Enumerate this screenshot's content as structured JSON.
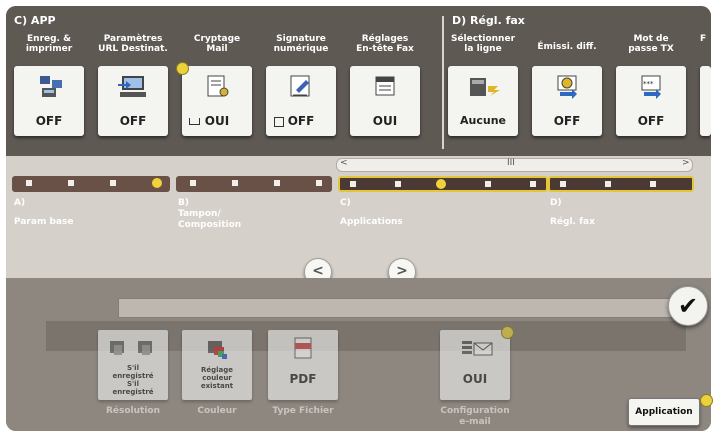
{
  "section_app": {
    "title": "C)  APP"
  },
  "section_fax": {
    "title": "D)  Régl. fax"
  },
  "app_buttons": [
    {
      "label": "Enreg. &\nimprimer",
      "value": "OFF",
      "icon": "scan-save-icon"
    },
    {
      "label": "Paramètres\nURL Destinat.",
      "value": "OFF",
      "icon": "url-destination-icon"
    },
    {
      "label": "Cryptage\nMail",
      "value": "OUI",
      "icon": "encrypt-mail-icon"
    },
    {
      "label": "Signature\nnumérique",
      "value": "OFF",
      "icon": "digital-signature-icon"
    },
    {
      "label": "Réglages\nEn-tête Fax",
      "value": "OUI",
      "icon": "fax-header-icon"
    }
  ],
  "fax_buttons": [
    {
      "label": "Sélectionner\nla ligne",
      "value": "Aucune",
      "icon": "line-select-icon"
    },
    {
      "label": "Émissi. diff.",
      "value": "OFF",
      "icon": "timer-send-icon"
    },
    {
      "label": "Mot de\npasse TX",
      "value": "OFF",
      "icon": "password-tx-icon"
    },
    {
      "label": "F"
    }
  ],
  "scroll": {
    "left": "<",
    "center": "III",
    "right": ">"
  },
  "tabs": [
    {
      "letter": "A)",
      "name": "Param base"
    },
    {
      "letter": "B)",
      "name": "Tampon/\nComposition"
    },
    {
      "letter": "C)",
      "name": "Applications"
    },
    {
      "letter": "D)",
      "name": "Régl. fax"
    }
  ],
  "nav": {
    "prev": "<",
    "next": ">"
  },
  "bottom_tiles": [
    {
      "text": "S'il\nenregistré\nS'il\nenregistré",
      "label": "Résolution"
    },
    {
      "text": "Réglage\ncouleur\nexistant",
      "label": "Couleur"
    },
    {
      "text": "PDF",
      "label": "Type Fichier"
    },
    {
      "text": "OUI",
      "label": "Configuration\ne-mail"
    }
  ],
  "ok_button": "✔",
  "application_button": "Application",
  "colors": {
    "accent": "#e9d23b",
    "panel": "#5f5954",
    "tile": "#f4f4f1"
  }
}
